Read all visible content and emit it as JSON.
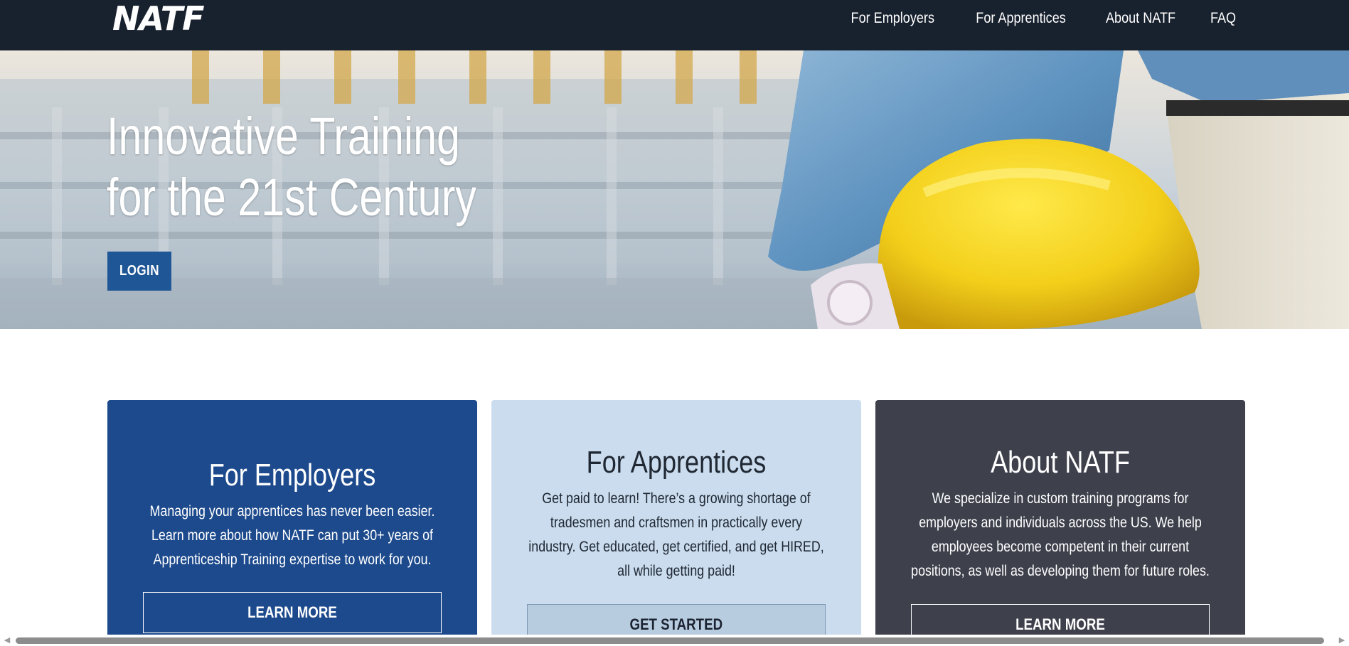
{
  "nav": {
    "logo": "NATF",
    "links": [
      "For Employers",
      "For Apprentices",
      "About NATF",
      "FAQ"
    ]
  },
  "hero": {
    "title_line1": "Innovative Training",
    "title_line2": "for the 21st Century",
    "login_label": "LOGIN",
    "image_description_icon": "hard-hat-photo"
  },
  "cards": [
    {
      "title": "For Employers",
      "text": "Managing your apprentices has never been easier. Learn more about how NATF can put 30+ years of Apprenticeship Training expertise to work for you.",
      "button": "LEARN MORE"
    },
    {
      "title": "For Apprentices",
      "text": "Get paid to learn! There’s a growing shortage of tradesmen and craftsmen in practically every industry. Get educated, get certified, and get HIRED, all while getting paid!",
      "button": "GET STARTED"
    },
    {
      "title": "About NATF",
      "text": "We specialize in custom training programs for employers and individuals across the US. We help employees become competent in their current positions, as well as developing them for future roles.",
      "button": "LEARN MORE"
    }
  ],
  "colors": {
    "navbar": "#18212e",
    "primary_blue": "#1f5696",
    "card_employers": "#1d4a8c",
    "card_apprentices": "#cadcee",
    "card_about": "#3e414c"
  }
}
